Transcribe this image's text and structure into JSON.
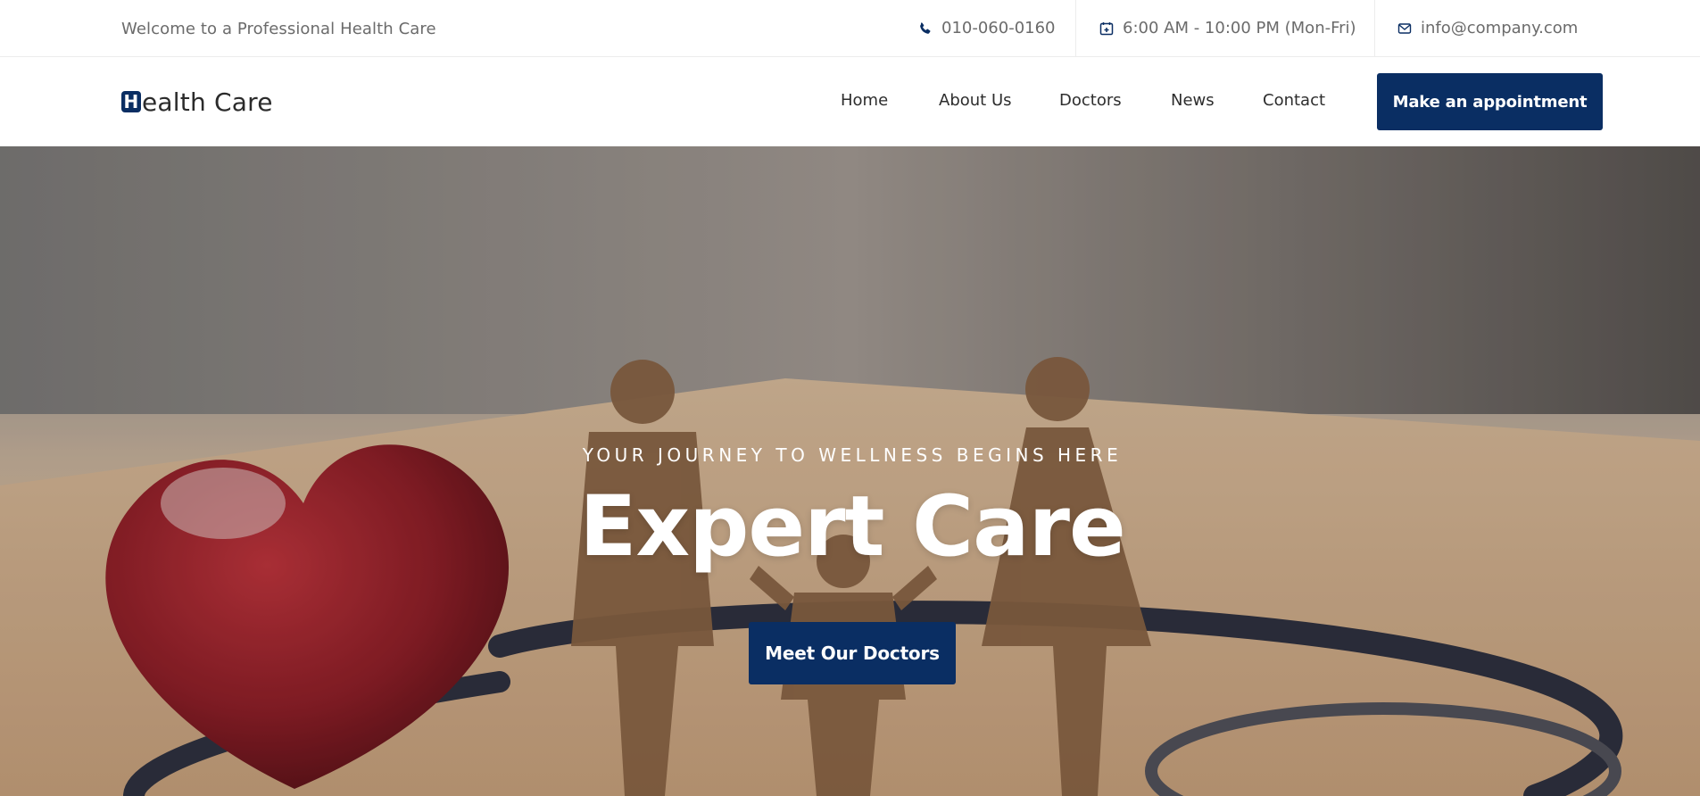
{
  "topbar": {
    "welcome": "Welcome to a Professional Health Care",
    "phone": "010-060-0160",
    "hours": "6:00 AM - 10:00 PM (Mon-Fri)",
    "email": "info@company.com",
    "icons": [
      "phone-icon",
      "calendar-icon",
      "envelope-icon"
    ]
  },
  "header": {
    "logo_initial": "H",
    "logo_rest": "ealth Care",
    "nav": [
      "Home",
      "About Us",
      "Doctors",
      "News",
      "Contact"
    ],
    "cta": "Make an appointment"
  },
  "hero": {
    "subtitle": "YOUR JOURNEY TO WELLNESS BEGINS HERE",
    "title": "Expert Care",
    "button": "Meet Our Doctors"
  },
  "colors": {
    "brand": "#0a2e63",
    "muted_text": "#6b6b6b",
    "nav_text": "#2d2d2d"
  }
}
